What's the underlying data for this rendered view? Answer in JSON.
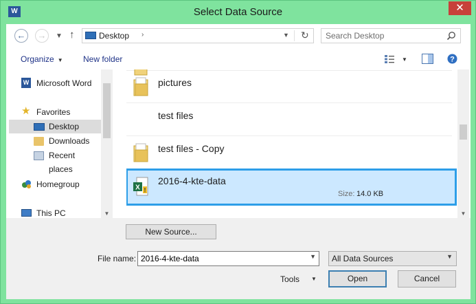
{
  "window": {
    "title": "Select Data Source",
    "close_symbol": "✕",
    "app_icon_text": "W"
  },
  "address_bar": {
    "location": "Desktop"
  },
  "search": {
    "placeholder": "Search Desktop"
  },
  "toolbar": {
    "organize_label": "Organize",
    "new_folder_label": "New folder"
  },
  "nav_pane": {
    "items": [
      {
        "label": "Microsoft Word",
        "icon": "word-icon"
      },
      {
        "label": "Favorites",
        "icon": "star-icon"
      },
      {
        "label": "Desktop",
        "icon": "desktop-icon",
        "selected": true
      },
      {
        "label": "Downloads",
        "icon": "downloads-folder-icon"
      },
      {
        "label": "Recent places",
        "icon": "recent-places-icon"
      },
      {
        "label": "Homegroup",
        "icon": "homegroup-icon"
      },
      {
        "label": "This PC",
        "icon": "computer-icon"
      }
    ]
  },
  "files": [
    {
      "name": "pictures",
      "icon": "folder-icon"
    },
    {
      "name": "test files",
      "icon": "none"
    },
    {
      "name": "test files - Copy",
      "icon": "folder-icon"
    },
    {
      "name": "2016-4-kte-data",
      "icon": "excel-file-icon",
      "size_label": "Size:",
      "size": "14.0 KB",
      "selected": true
    }
  ],
  "new_source_button": "New Source...",
  "file_name": {
    "label": "File name:",
    "value": "2016-4-kte-data"
  },
  "file_type": {
    "selected": "All Data Sources"
  },
  "tools_label": "Tools",
  "open_button": "Open",
  "cancel_button": "Cancel",
  "colors": {
    "title_bar": "#7fe39e",
    "close_button": "#c7403a",
    "selection": "#cce8ff",
    "selection_border": "#2d9ee8"
  }
}
